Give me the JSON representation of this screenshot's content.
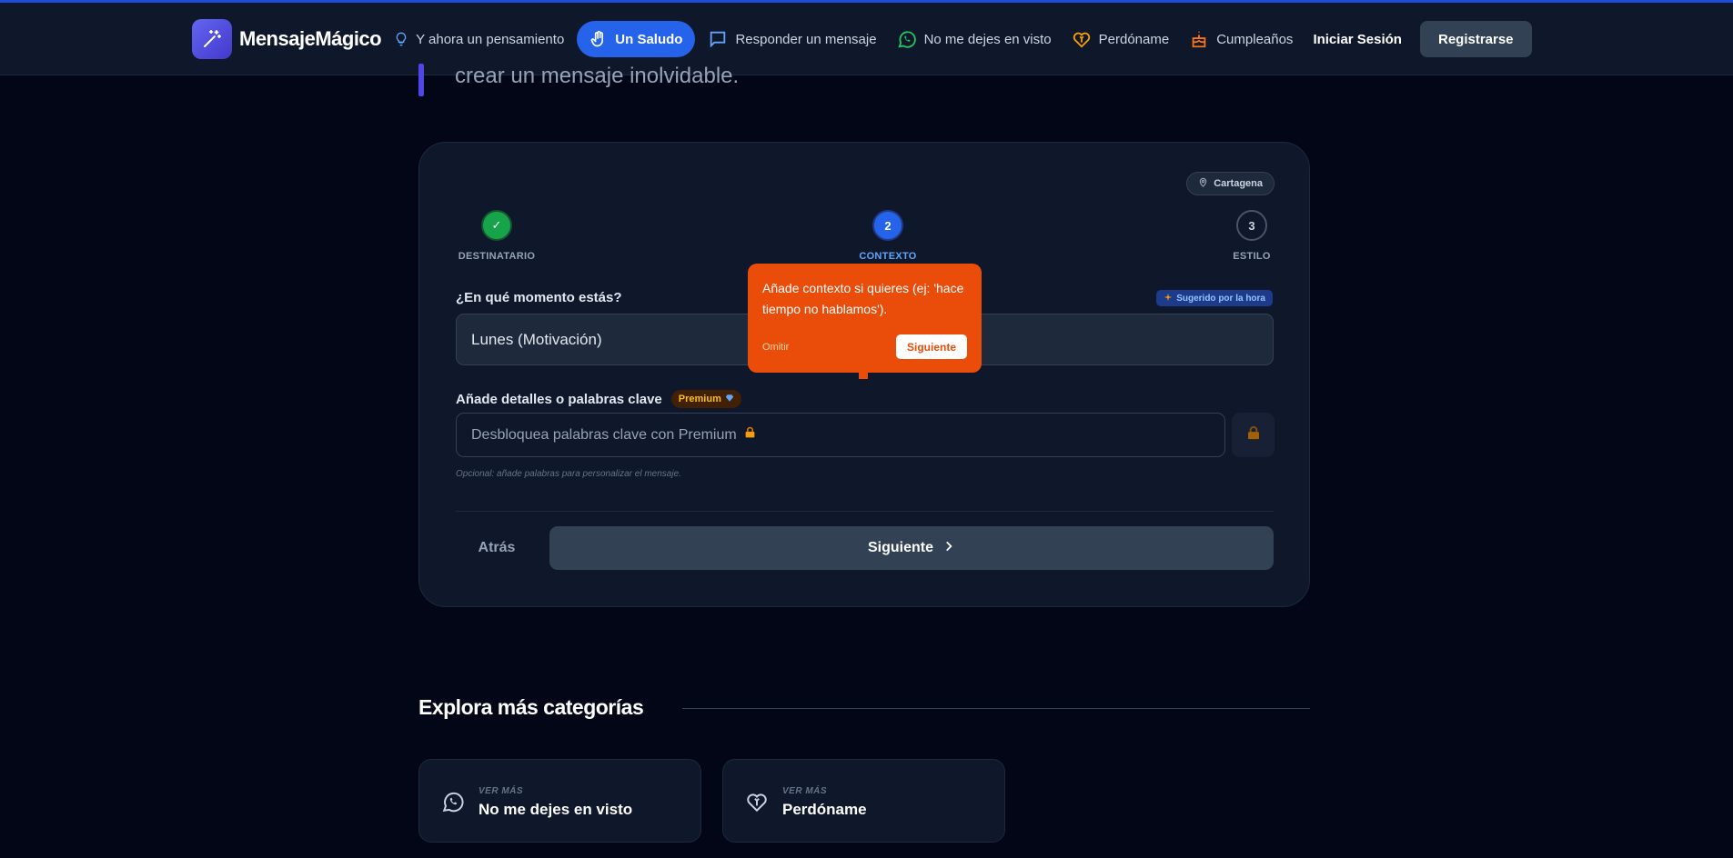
{
  "nav": {
    "brand": "MensajeMágico",
    "items": [
      {
        "label": "Y ahora un pensamiento",
        "icon": "lightbulb-icon"
      },
      {
        "label": "Un Saludo",
        "icon": "hand-wave-icon",
        "active": true
      },
      {
        "label": "Responder un mensaje",
        "icon": "chat-bubble-icon"
      },
      {
        "label": "No me dejes en visto",
        "icon": "whatsapp-icon"
      },
      {
        "label": "Perdóname",
        "icon": "heart-bandage-icon"
      },
      {
        "label": "Cumpleaños",
        "icon": "cake-icon"
      }
    ],
    "login": "Iniciar Sesión",
    "register": "Registrarse"
  },
  "intro": {
    "text": "crear un mensaje inolvidable."
  },
  "form": {
    "location": "Cartagena",
    "steps": [
      {
        "number": "✓",
        "label": "DESTINATARIO",
        "status": "done"
      },
      {
        "number": "2",
        "label": "CONTEXTO",
        "status": "current"
      },
      {
        "number": "3",
        "label": "ESTILO",
        "status": "pending"
      }
    ],
    "moment": {
      "label": "¿En qué momento estás?",
      "suggested": "Sugerido por la hora",
      "value": "Lunes (Motivación)"
    },
    "keywords": {
      "label": "Añade detalles o palabras clave",
      "premium": "Premium",
      "placeholder": "Desbloquea palabras clave con Premium",
      "hint": "Opcional: añade palabras para personalizar el mensaje."
    },
    "back": "Atrás",
    "next": "Siguiente"
  },
  "tooltip": {
    "text": "Añade contexto si quieres (ej: 'hace tiempo no hablamos').",
    "skip": "Omitir",
    "next": "Siguiente"
  },
  "explore": {
    "title": "Explora más categorías",
    "cards": [
      {
        "eyebrow": "VER MÁS",
        "title": "No me dejes en visto",
        "icon": "whatsapp-icon"
      },
      {
        "eyebrow": "VER MÁS",
        "title": "Perdóname",
        "icon": "heart-bandage-icon"
      }
    ]
  },
  "colors": {
    "background": "#020617",
    "panel": "#0f172a",
    "accent": "#2563eb",
    "success": "#16a34a",
    "tooltip": "#ea4c0a",
    "premium": "#fbbf24"
  }
}
